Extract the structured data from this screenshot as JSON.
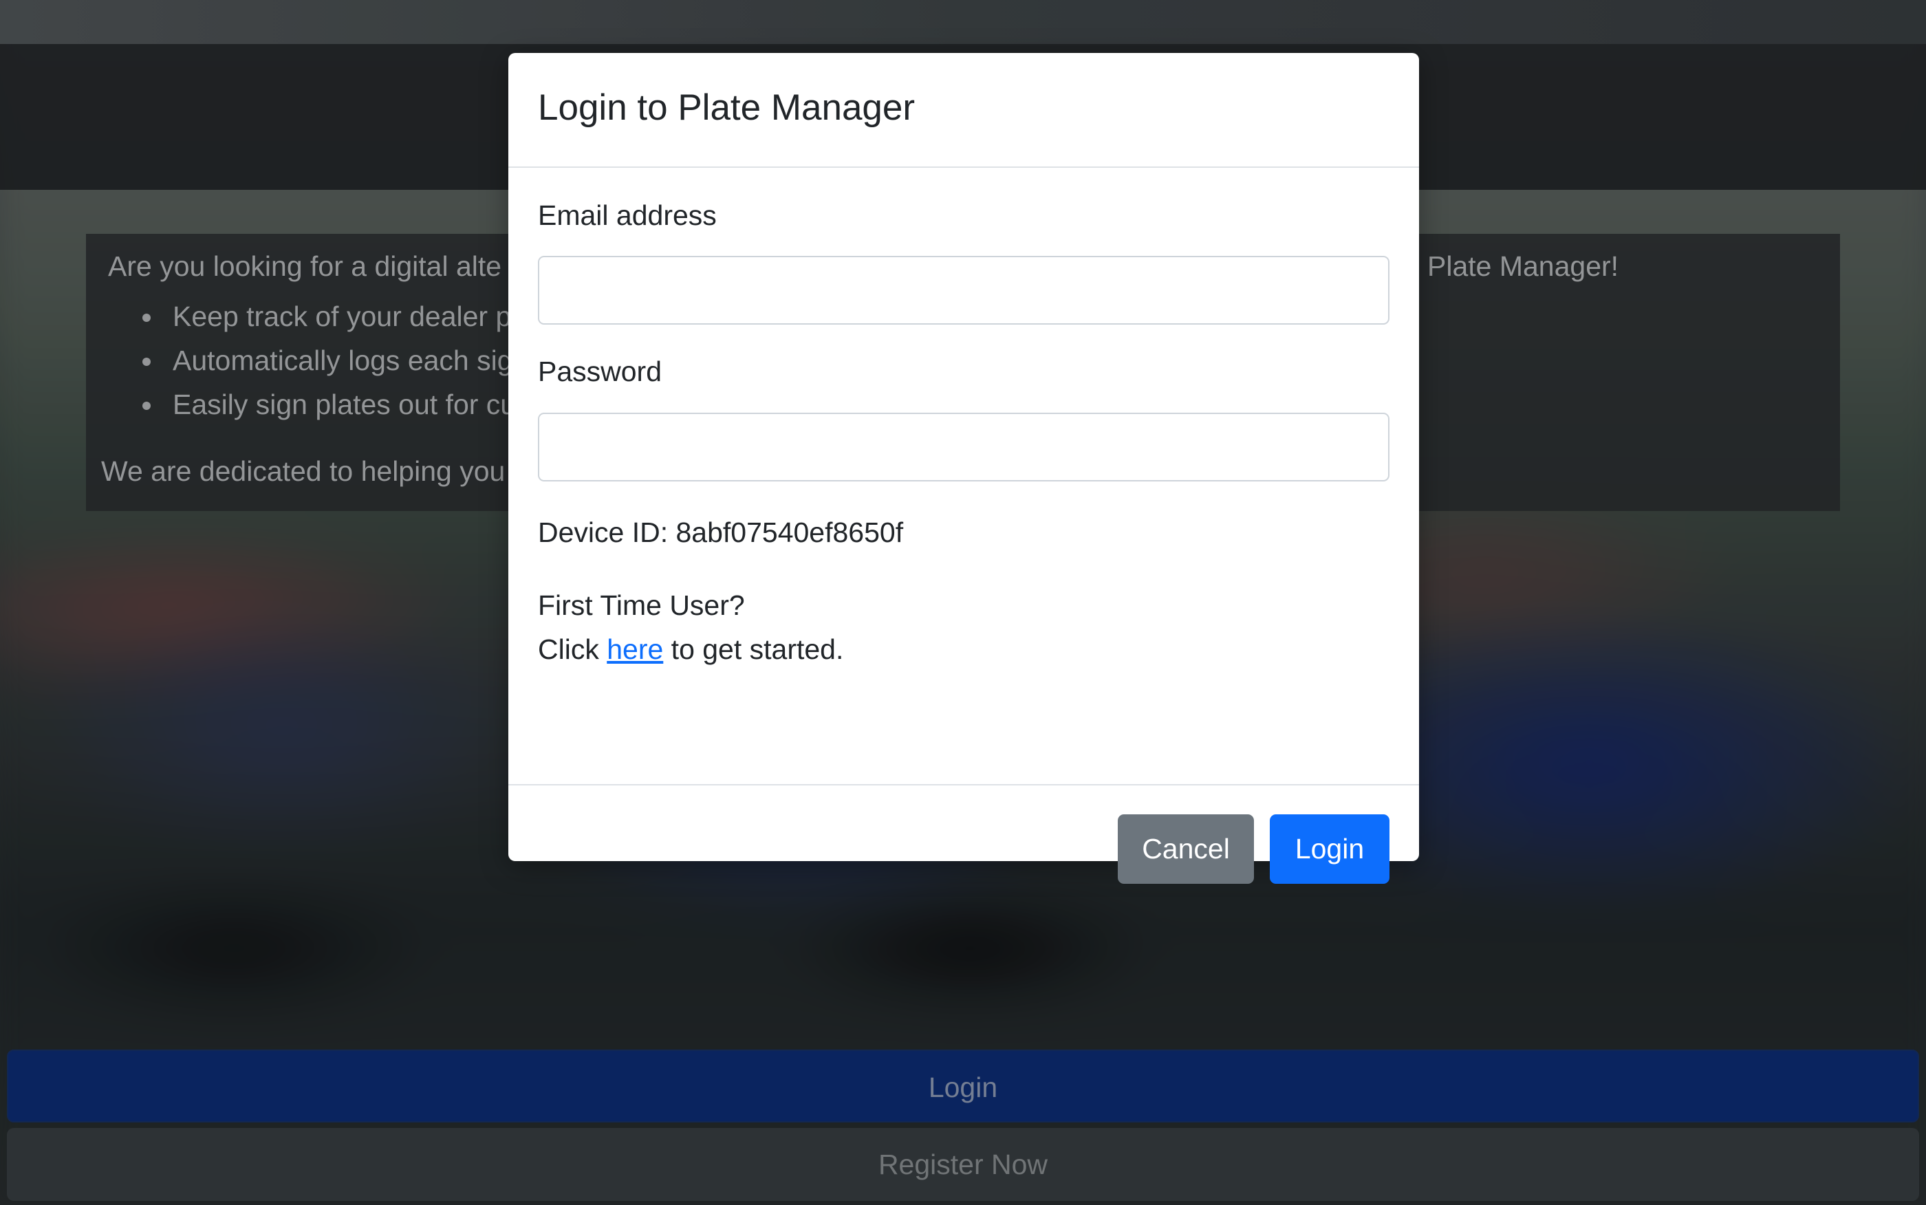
{
  "background": {
    "intro": {
      "lead": "Are you looking for a digital alte",
      "bullets": [
        "Keep track of your dealer p",
        "Automatically logs each sig",
        "Easily sign plates out for cu"
      ],
      "tail": "We are dedicated to helping you",
      "right_fragment": "Plate Manager!"
    },
    "login_button": "Login",
    "register_button": "Register Now"
  },
  "modal": {
    "title": "Login to Plate Manager",
    "email": {
      "label": "Email address",
      "value": "",
      "placeholder": ""
    },
    "password": {
      "label": "Password",
      "value": "",
      "placeholder": ""
    },
    "device_id": "Device ID: 8abf07540ef8650f",
    "first_time_label": "First Time User?",
    "click_prefix": "Click ",
    "here_link": "here",
    "click_suffix": " to get started.",
    "cancel_button": "Cancel",
    "login_button": "Login"
  },
  "colors": {
    "primary": "#0d6efd",
    "secondary": "#6c757d",
    "backdrop_login": "#0c2a6d"
  }
}
